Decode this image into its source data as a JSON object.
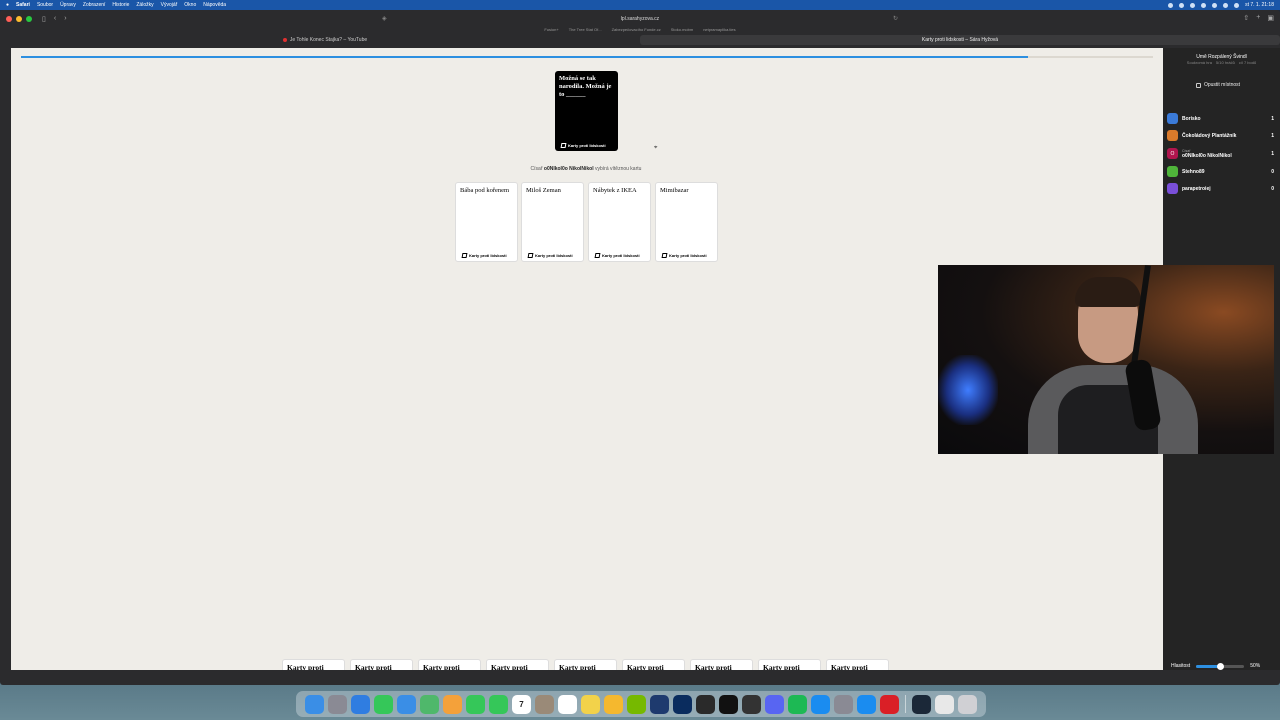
{
  "menubar": {
    "app_name": "Safari",
    "items": [
      "Soubor",
      "Úpravy",
      "Zobrazení",
      "Historie",
      "Záložky",
      "Vývojář",
      "Okno",
      "Nápověda"
    ],
    "clock": "st 7. 1. 21:18"
  },
  "browser": {
    "url": "lpl.sarahyzova.cz",
    "favorites": [
      "Fusion+",
      "The Tree Stat Of...",
      "Zabezpečovacího Fonde.cz",
      "Stoko.mobm",
      "netpramaplika.ties"
    ],
    "tabs": [
      {
        "title": "Je Tohle Konec Stajka? – YouTube"
      },
      {
        "title": "Karty proti lidskosti – Sára Hyžová"
      }
    ]
  },
  "game": {
    "progress": 0.89,
    "black_card": {
      "text": "Možná se tak narodila. Možná je to ______",
      "brand": "Karty proti lidskosti"
    },
    "choose_message": {
      "prefix": "Císař",
      "czar": "o0NIkol0o NikolNikol",
      "suffix": "vybírá vítěznou kartu"
    },
    "white_cards": [
      {
        "text": "Bába pod kořenem",
        "brand": "Karty proti lidskosti"
      },
      {
        "text": "Miloš Zeman",
        "brand": "Karty proti lidskosti"
      },
      {
        "text": "Nábytek z IKEA",
        "brand": "Karty proti lidskosti"
      },
      {
        "text": "Mimibazar",
        "brand": "Karty proti lidskosti"
      }
    ],
    "hand_cards": [
      "Karty proti",
      "Karty proti",
      "Karty proti",
      "Karty proti",
      "Karty proti",
      "Karty proti",
      "Karty proti",
      "Karty proti",
      "Karty proti"
    ]
  },
  "sidebar": {
    "room_name": "Umě Rozpálený Švindl",
    "meta": [
      "Soukromá hra",
      "5/10 hráčů",
      "cíl 7 bodů"
    ],
    "leave_label": "Opustit místnost",
    "players": [
      {
        "name": "Borisko",
        "czar_label": "",
        "score": "1",
        "color": "#3b7bd9",
        "initial": ""
      },
      {
        "name": "Čokoládový Plantážník",
        "czar_label": "",
        "score": "1",
        "color": "#d97a2b",
        "initial": ""
      },
      {
        "name": "o0NIkol0o NikolNikol",
        "czar_label": "Císař",
        "score": "1",
        "color": "#b0154e",
        "initial": "O"
      },
      {
        "name": "Stehno89",
        "czar_label": "",
        "score": "0",
        "color": "#4fb53a",
        "initial": ""
      },
      {
        "name": "parapetroiej",
        "czar_label": "",
        "score": "0",
        "color": "#7a4fd9",
        "initial": ""
      }
    ],
    "volume_label": "Hlasitost",
    "volume_value": "50%",
    "volume_level": 0.5
  },
  "dock": {
    "icons": [
      "finder-icon",
      "launchpad-icon",
      "safari-icon",
      "messages-icon",
      "mail-icon",
      "maps-icon",
      "photos-icon",
      "facetime-icon",
      "phone-icon",
      "calendar-icon",
      "contacts-icon",
      "reminders-icon",
      "notes-icon",
      "notes-yellow-icon",
      "nvidia-icon",
      "lightroom-icon",
      "photoshop-icon",
      "activity-icon",
      "appletv-icon",
      "obs-icon",
      "discord-icon",
      "spotify-icon",
      "appstore-icon",
      "settings-icon",
      "iphone-mirroring-icon",
      "creative-cloud-icon",
      "steam-icon",
      "document-icon",
      "trash-icon"
    ],
    "calendar_day": "7"
  }
}
